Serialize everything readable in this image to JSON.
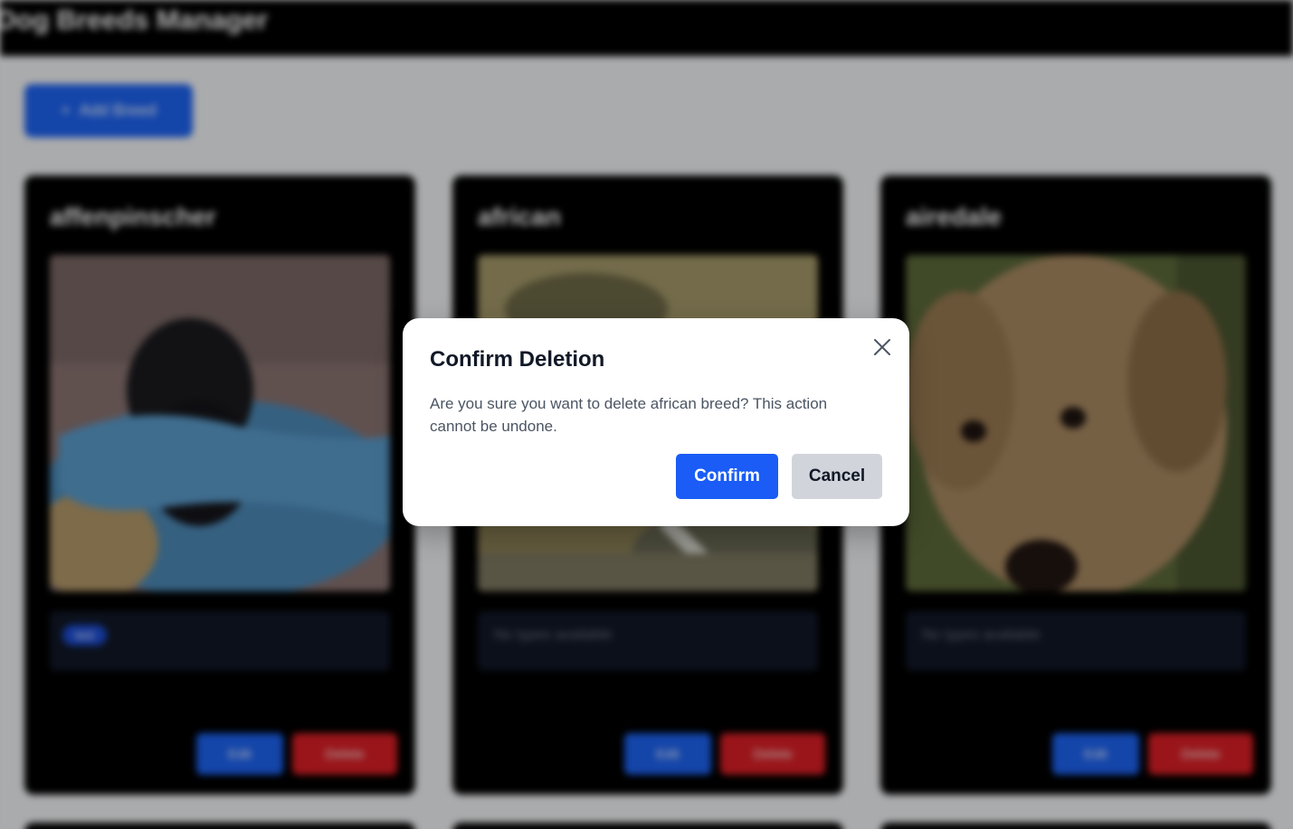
{
  "app": {
    "title": "Dog Breeds Manager"
  },
  "toolbar": {
    "add_label": "Add Breed",
    "add_icon": "plus-icon"
  },
  "cards": [
    {
      "name": "affenpinscher",
      "types": [
        "test"
      ],
      "empty_types_text": "",
      "edit_label": "Edit",
      "delete_label": "Delete"
    },
    {
      "name": "african",
      "types": [],
      "empty_types_text": "No types available",
      "edit_label": "Edit",
      "delete_label": "Delete"
    },
    {
      "name": "airedale",
      "types": [],
      "empty_types_text": "No types available",
      "edit_label": "Edit",
      "delete_label": "Delete"
    }
  ],
  "modal": {
    "title": "Confirm Deletion",
    "message": "Are you sure you want to delete african breed? This action cannot be undone.",
    "confirm_label": "Confirm",
    "cancel_label": "Cancel",
    "close_icon": "close-icon"
  },
  "colors": {
    "primary": "#1a5cf5",
    "danger": "#dc1f26",
    "cancel_bg": "#d1d5db",
    "header_bg": "#000000"
  }
}
